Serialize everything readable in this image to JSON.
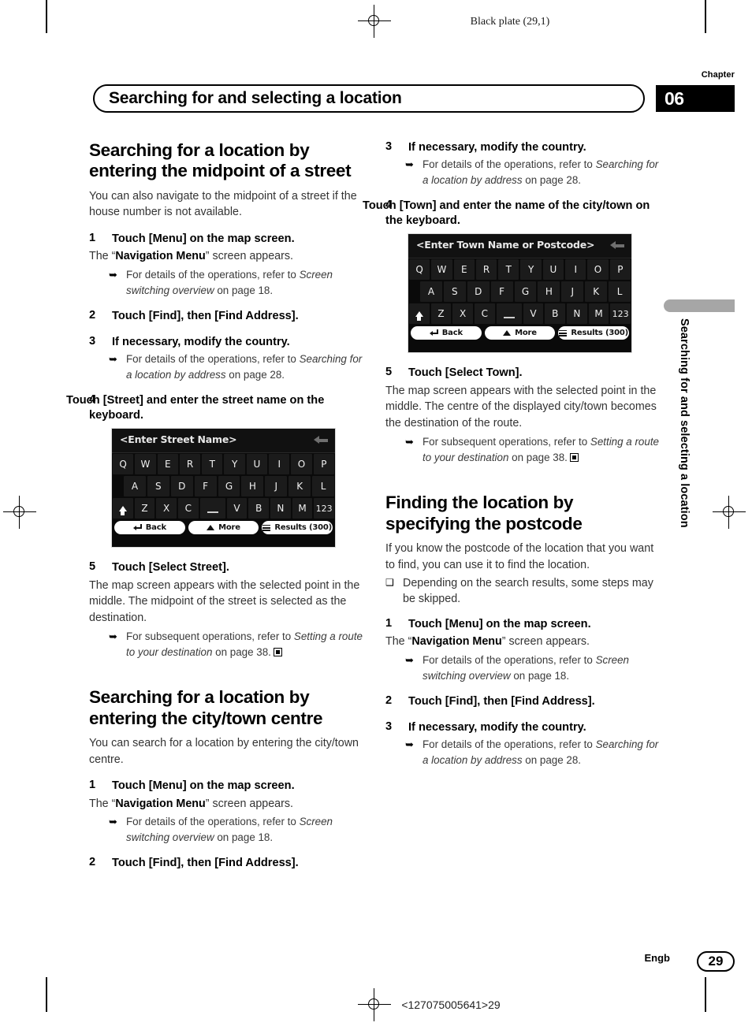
{
  "page": {
    "plate": "Black plate (29,1)",
    "chapter_label": "Chapter",
    "chapter_number": "06",
    "running_title": "Searching for and selecting a location",
    "side_tab": "Searching for and selecting a location",
    "language": "Engb",
    "page_number": "29",
    "print_code": "<127075005641>29"
  },
  "left_column": {
    "section1": {
      "heading": "Searching for a location by entering the midpoint of a street",
      "intro": "You can also navigate to the midpoint of a street if the house number is not available.",
      "steps": [
        {
          "num": "1",
          "text": "Touch [Menu] on the map screen.",
          "result_prefix": "The “",
          "result_bold": "Navigation Menu",
          "result_suffix": "” screen appears.",
          "note_bullet": "➥",
          "note_plain1": "For details of the operations, refer to ",
          "note_italic": "Screen switching overview",
          "note_plain2": " on page 18."
        },
        {
          "num": "2",
          "text": "Touch [Find], then [Find Address]."
        },
        {
          "num": "3",
          "text": "If necessary, modify the country.",
          "note_bullet": "➥",
          "note_plain1": "For details of the operations, refer to ",
          "note_italic": "Searching for a location by address",
          "note_plain2": " on page 28."
        },
        {
          "num": "4",
          "text": "Touch [Street] and enter the street name on the keyboard."
        },
        {
          "num": "5",
          "text": "Touch [Select Street].",
          "result_plain": "The map screen appears with the selected point in the middle. The midpoint of the street is selected as the destination.",
          "note_bullet": "➥",
          "note_plain1": "For subsequent operations, refer to ",
          "note_italic": "Setting a route to your destination",
          "note_plain2": " on page 38."
        }
      ]
    },
    "section2": {
      "heading": "Searching for a location by entering the city/town centre",
      "intro": "You can search for a location by entering the city/town centre.",
      "steps": [
        {
          "num": "1",
          "text": "Touch [Menu] on the map screen.",
          "result_prefix": "The “",
          "result_bold": "Navigation Menu",
          "result_suffix": "” screen appears.",
          "note_bullet": "➥",
          "note_plain1": "For details of the operations, refer to ",
          "note_italic": "Screen switching overview",
          "note_plain2": " on page 18."
        },
        {
          "num": "2",
          "text": "Touch [Find], then [Find Address]."
        }
      ]
    },
    "keyboard": {
      "placeholder": "<Enter Street Name>",
      "backspace_icon": "backspace-arrow-icon",
      "row1": [
        "Q",
        "W",
        "E",
        "R",
        "T",
        "Y",
        "U",
        "I",
        "O",
        "P"
      ],
      "row2": [
        "A",
        "S",
        "D",
        "F",
        "G",
        "H",
        "J",
        "K",
        "L"
      ],
      "row3": [
        "Z",
        "X",
        "C",
        "V",
        "B",
        "N",
        "M"
      ],
      "shift_key": "shift-up-arrow-icon",
      "space_key": "_",
      "numeric_key": "123",
      "buttons": [
        {
          "icon": "return-arrow-icon",
          "label": "Back"
        },
        {
          "icon": "mountain-icon",
          "label": "More"
        },
        {
          "icon": "list-icon",
          "label": "Results (300)"
        }
      ]
    }
  },
  "right_column": {
    "continued_steps": [
      {
        "num": "3",
        "text": "If necessary, modify the country.",
        "note_bullet": "➥",
        "note_plain1": "For details of the operations, refer to ",
        "note_italic": "Searching for a location by address",
        "note_plain2": " on page 28."
      },
      {
        "num": "4",
        "text": "Touch [Town] and enter the name of the city/town on the keyboard."
      },
      {
        "num": "5",
        "text": "Touch [Select Town].",
        "result_plain": "The map screen appears with the selected point in the middle. The centre of the displayed city/town becomes the destination of the route.",
        "note_bullet": "➥",
        "note_plain1": "For subsequent operations, refer to ",
        "note_italic": "Setting a route to your destination",
        "note_plain2": " on page 38."
      }
    ],
    "section3": {
      "heading": "Finding the location by specifying the postcode",
      "intro": "If you know the postcode of the location that you want to find, you can use it to find the location.",
      "bullet_symbol": "❑",
      "bullet_text": "Depending on the search results, some steps may be skipped.",
      "steps": [
        {
          "num": "1",
          "text": "Touch [Menu] on the map screen.",
          "result_prefix": "The “",
          "result_bold": "Navigation Menu",
          "result_suffix": "” screen appears.",
          "note_bullet": "➥",
          "note_plain1": "For details of the operations, refer to ",
          "note_italic": "Screen switching overview",
          "note_plain2": " on page 18."
        },
        {
          "num": "2",
          "text": "Touch [Find], then [Find Address]."
        },
        {
          "num": "3",
          "text": "If necessary, modify the country.",
          "note_bullet": "➥",
          "note_plain1": "For details of the operations, refer to ",
          "note_italic": "Searching for a location by address",
          "note_plain2": " on page 28."
        }
      ]
    },
    "keyboard": {
      "placeholder": "<Enter Town Name or Postcode>",
      "backspace_icon": "backspace-arrow-icon",
      "row1": [
        "Q",
        "W",
        "E",
        "R",
        "T",
        "Y",
        "U",
        "I",
        "O",
        "P"
      ],
      "row2": [
        "A",
        "S",
        "D",
        "F",
        "G",
        "H",
        "J",
        "K",
        "L"
      ],
      "row3": [
        "Z",
        "X",
        "C",
        "V",
        "B",
        "N",
        "M"
      ],
      "shift_key": "shift-up-arrow-icon",
      "space_key": "_",
      "numeric_key": "123",
      "buttons": [
        {
          "icon": "return-arrow-icon",
          "label": "Back"
        },
        {
          "icon": "mountain-icon",
          "label": "More"
        },
        {
          "icon": "list-icon",
          "label": "Results (300)"
        }
      ]
    }
  }
}
